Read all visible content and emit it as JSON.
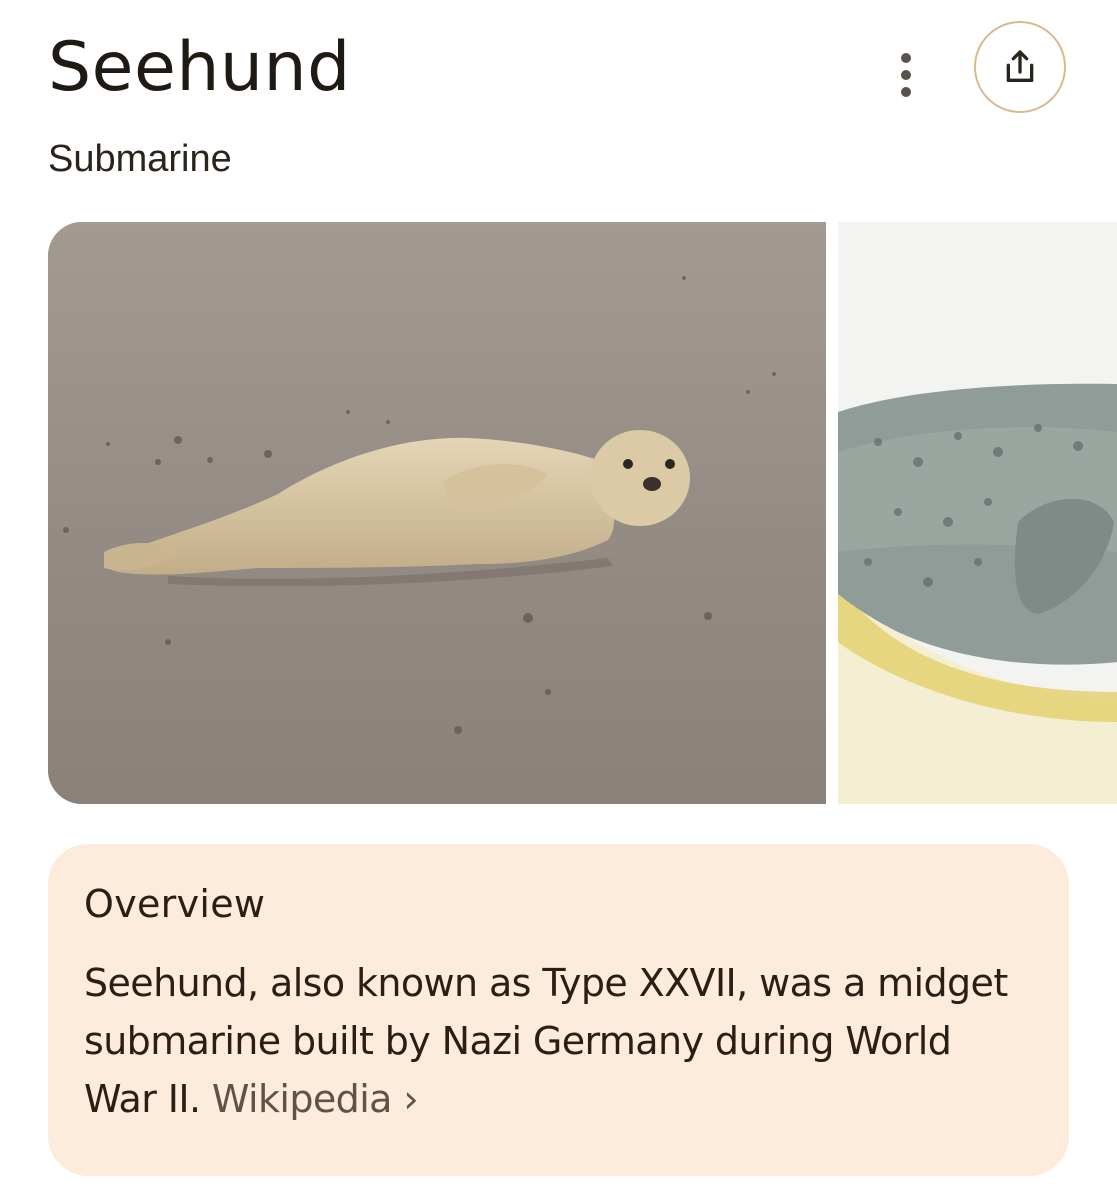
{
  "header": {
    "title": "Seehund",
    "subtitle": "Submarine",
    "more_icon": "more-vert-icon",
    "share_icon": "share-icon"
  },
  "gallery": {
    "images": [
      {
        "alt": "seal-photo",
        "subject": "harbor seal on beach"
      },
      {
        "alt": "seal-illustration",
        "subject": "seal illustration"
      }
    ]
  },
  "overview": {
    "title": "Overview",
    "text": "Seehund, also known as Type XXVII, was a midget submarine built by Nazi Germany during World War II.",
    "source_link": "Wikipedia",
    "link_chevron": "›"
  },
  "colors": {
    "card_bg": "#fdebdb",
    "share_border": "#d8b98e",
    "text": "#1f1a14"
  }
}
